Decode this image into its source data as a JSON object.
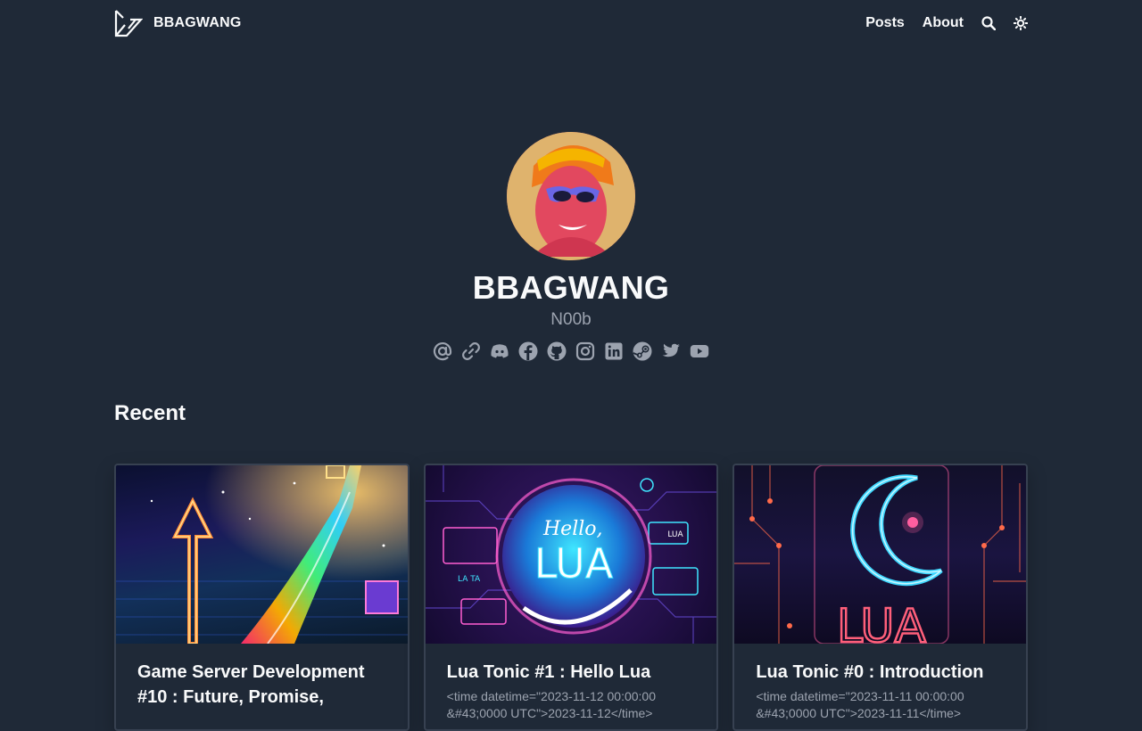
{
  "header": {
    "brand": "BBAGWANG",
    "nav": [
      {
        "label": "Posts"
      },
      {
        "label": "About"
      }
    ],
    "icons": [
      "search-icon",
      "theme-toggle-icon"
    ]
  },
  "profile": {
    "name": "BBAGWANG",
    "tagline": "N00b",
    "socials": [
      "email",
      "link",
      "discord",
      "facebook",
      "github",
      "instagram",
      "linkedin",
      "steam",
      "twitter",
      "youtube"
    ]
  },
  "recent": {
    "heading": "Recent",
    "posts": [
      {
        "title": "Game Server Development #10 : Future, Promise,",
        "meta": ""
      },
      {
        "title": "Lua Tonic #1 : Hello Lua",
        "meta": "<time datetime=\"2023-11-12 00:00:00 &#43;0000 UTC\">2023-11-12</time>"
      },
      {
        "title": "Lua Tonic #0 : Introduction",
        "meta": "<time datetime=\"2023-11-11 00:00:00 &#43;0000 UTC\">2023-11-11</time>"
      }
    ],
    "thumb_text": {
      "post2_hello": "Hello,",
      "post2_lua": "LUA",
      "post2_small_lua": "LUA",
      "post2_la_ta": "LA TA",
      "post3_lua": "LUA"
    }
  },
  "colors": {
    "background": "#1f2937",
    "text": "#f9fafb",
    "muted": "#9ca3af",
    "card_border": "#374151"
  }
}
